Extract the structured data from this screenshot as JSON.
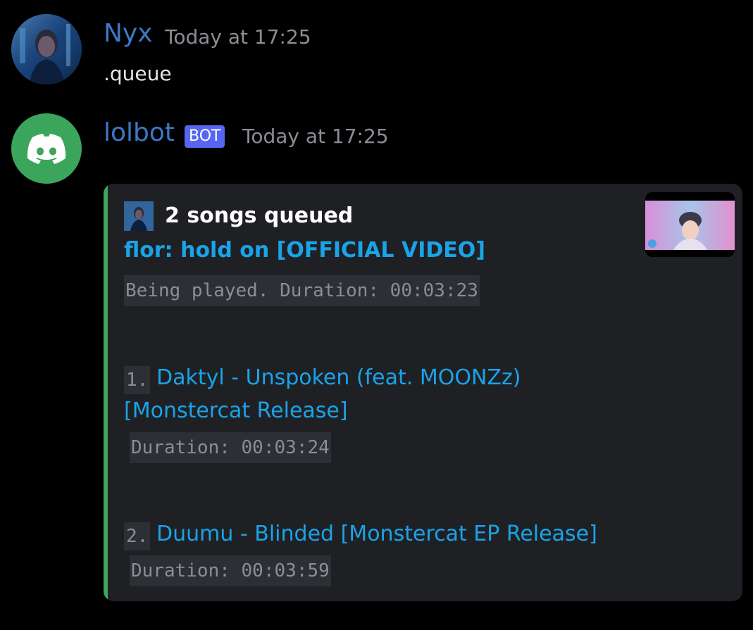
{
  "messages": [
    {
      "author": "Nyx",
      "timestamp": "Today at 17:25",
      "text": ".queue"
    },
    {
      "author": "lolbot",
      "badge": "BOT",
      "timestamp": "Today at 17:25"
    }
  ],
  "embed": {
    "title": "2 songs queued",
    "now_playing": {
      "title": "flor: hold on [OFFICIAL VIDEO]",
      "status": "Being played. Duration: 00:03:23"
    },
    "queue": [
      {
        "index": "1.",
        "title_line1": "Daktyl - Unspoken (feat. MOONZz)",
        "title_line2": "[Monstercat Release]",
        "duration": "Duration: 00:03:24"
      },
      {
        "index": "2.",
        "title_line1": "Duumu - Blinded [Monstercat EP Release]",
        "duration": "Duration: 00:03:59"
      }
    ]
  },
  "colors": {
    "background": "#000000",
    "author": "#3d78c6",
    "link": "#1aa3e8",
    "embed_bar": "#3ba55c",
    "embed_bg": "#1f2024",
    "bot_badge": "#5865f2"
  },
  "icons": {
    "user_avatar": "user-avatar",
    "bot_avatar": "discord-logo-icon",
    "embed_author": "user-avatar-small",
    "thumbnail": "video-thumbnail"
  }
}
